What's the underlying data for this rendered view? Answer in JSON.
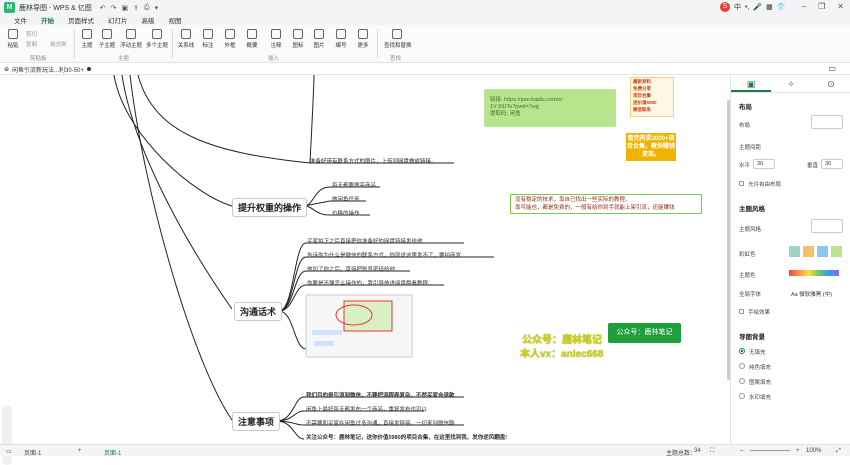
{
  "app": {
    "title": "鹿林导图 - WPS & 亿图"
  },
  "ime": {
    "items": [
      "中",
      "•,",
      "🎤",
      "▦",
      "👕",
      "⋯"
    ]
  },
  "menu": {
    "items": [
      "文件",
      "开始",
      "页面样式",
      "幻灯片",
      "高级",
      "视图"
    ],
    "active_index": 1
  },
  "ribbon": {
    "clipboard": {
      "paste": "粘贴",
      "cut": "剪切",
      "copy": "复制",
      "format": "格式刷",
      "group": "剪贴板"
    },
    "topic": {
      "buttons": [
        "主题",
        "子主题",
        "浮动主题",
        "多个主题"
      ],
      "group": "主题"
    },
    "insert": {
      "buttons": [
        "关系线",
        "标注",
        "外框",
        "概要",
        "注释",
        "图标",
        "图片",
        "编号",
        "更多"
      ],
      "group": "插入"
    },
    "find": {
      "button": "查找和替换",
      "group": "查找"
    }
  },
  "doc_tab": {
    "name": "闲鱼引流新玩法...利30-50+"
  },
  "mindmap": {
    "main_nodes": [
      {
        "label": "提升权重的操作"
      },
      {
        "label": "沟通话术"
      },
      {
        "label": "注意事项"
      }
    ],
    "top_text": "准备好带有联系方式的图片，上传到网盘做成链接。",
    "link_box": {
      "line1": "链接: https://pan.baidu.com/s/",
      "line2": "1V",
      "line3": "6lUTe?pwd=7sqj",
      "line4": "提取码:",
      "line5": "闲鱼"
    },
    "weight_leaves": [
      "每天都要擦亮商品",
      "做闲鱼任务",
      "价格的操作"
    ],
    "popup_text": "没有稳定的技术，靠自己找出一些实际的教程。\n靠可能也，都是免费的，一般有给你到手就能上架引流，还能赚钱",
    "talk_leaves": [
      "买家拍下之后直接把你准备好的网盘链接发给他",
      "告诉你为什么是微信的联系方式，你就说这里发不了，要拍商发",
      "他加了你之后，直接把账号密码给他",
      "你要是不懂怎么操作的，我引导他进阅盘群看教程"
    ],
    "note_leaves": [
      "我们目的是引流到微信，不要把流程弄复杂，不然买家会退款",
      "闲鱼上最好每天都发布一个商品，重复发布也可以",
      "不需要和买家在闲鱼过多沟通，直接发链接，一切来到微信聊",
      "关注公众号：鹿林笔记，送你价值5980的项目合集，在这里找到我，发你逆风翻盘!"
    ],
    "orange_notes": [
      "最新资料",
      "免费分享",
      "项目合集",
      "送价值5980",
      "微信联系",
      "鹿林笔记"
    ],
    "orange_banner": "看完再说3000+项目合集，教你赚钱变现。",
    "watermark": {
      "line1": "公众号：鹿林笔记",
      "line2": "本人vx：anlec668",
      "tag": "公众号：鹿林笔记"
    }
  },
  "sidebar": {
    "layout": {
      "title": "布局",
      "layout_label": "布局",
      "spacing_label": "主题间距",
      "h_label": "水平",
      "h_value": "30",
      "v_label": "垂直",
      "v_value": "30",
      "free_label": "允许自由布局"
    },
    "style": {
      "title": "主题风格",
      "theme_label": "主题风格",
      "rainbow_label": "彩虹色",
      "color_label": "主题色",
      "font_label": "全局字体",
      "font_value": "Aa 微软雅黑 (中)",
      "hand_label": "手绘效果"
    },
    "bg": {
      "title": "导图背景",
      "options": [
        "无填充",
        "纯色填充",
        "图案填充",
        "水印填充"
      ],
      "selected": 0
    }
  },
  "status": {
    "page": "页面-1",
    "add": "+",
    "page_tab": "页面-1",
    "count_label": "主题总数：",
    "count": "34",
    "zoom": "100%"
  }
}
